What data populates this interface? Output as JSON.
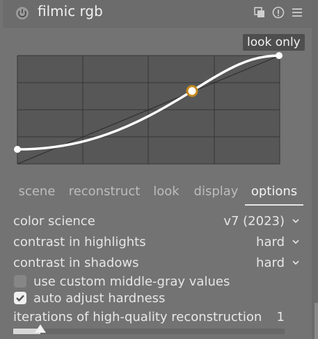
{
  "module": {
    "title": "filmic rgb",
    "icons": [
      "power-icon",
      "multi-instance-icon",
      "reset-icon",
      "presets-menu-icon"
    ]
  },
  "graph": {
    "view_label": "look only",
    "grid_color": "#575757",
    "curve_color": "#ffffff",
    "node_color": "#c38a1e"
  },
  "tabs": [
    {
      "label": "scene"
    },
    {
      "label": "reconstruct"
    },
    {
      "label": "look"
    },
    {
      "label": "display"
    },
    {
      "label": "options",
      "active": true
    }
  ],
  "settings": {
    "color_science": {
      "label": "color science",
      "value": "v7 (2023)"
    },
    "contrast_highlights": {
      "label": "contrast in highlights",
      "value": "hard"
    },
    "contrast_shadows": {
      "label": "contrast in shadows",
      "value": "hard"
    },
    "custom_middle_gray": {
      "label": "use custom middle-gray values",
      "checked": false
    },
    "auto_adjust": {
      "label": "auto adjust hardness",
      "checked": true
    },
    "iterations": {
      "label": "iterations of high-quality reconstruction",
      "value": "1",
      "fraction": 0.1
    }
  }
}
